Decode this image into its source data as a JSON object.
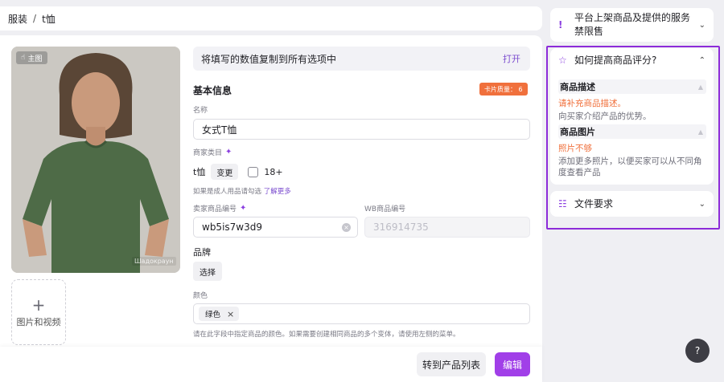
{
  "breadcrumb": {
    "root": "服装",
    "separator": "/",
    "current": "t恤"
  },
  "photo": {
    "main_badge": "主图",
    "watermark": "Шадокраун"
  },
  "add_media": {
    "icon": "+",
    "label": "图片和视频"
  },
  "form": {
    "copy_bar": {
      "text": "将填写的数值复制到所有选项中",
      "toggle": "打开"
    },
    "section_title": "基本信息",
    "quality_badge": "卡片质量： 6",
    "name_label": "名称",
    "name_value": "女式T恤",
    "category_label": "商家类目",
    "category_value": "t恤",
    "change_button": "变更",
    "adult_checkbox": "18+",
    "adult_hint": "如果是成人用品请勾选",
    "learn_more": "了解更多",
    "seller_sku_label": "卖家商品编号",
    "seller_sku_value": "wb5is7w3d9",
    "wb_sku_label": "WB商品编号",
    "wb_sku_value": "316914735",
    "brand_label": "品牌",
    "brand_select": "选择",
    "color_label": "颜色",
    "color_tag": "绿色",
    "color_hint": "请在此字段中指定商品的颜色。如果需要创建相同商品的多个变体，请使用左侧的菜单。"
  },
  "footer": {
    "to_list_button": "转到产品列表",
    "edit_button": "编辑"
  },
  "sidebar": {
    "policy": {
      "icon": "!",
      "title": "平台上架商品及提供的服务禁限售"
    },
    "rating": {
      "title": "如何提高商品评分?",
      "tips": [
        {
          "heading": "商品描述",
          "warning": "请补充商品描述。",
          "desc": "向买家介绍产品的优势。"
        },
        {
          "heading": "商品图片",
          "warning": "照片不够",
          "desc": "添加更多照片，以便买家可以从不同角度查看产品"
        }
      ]
    },
    "files": {
      "title": "文件要求"
    }
  },
  "help_button": "?",
  "colors": {
    "accent": "#a13fe8",
    "warning": "#f0703c",
    "highlight": "#8c2bd9"
  }
}
